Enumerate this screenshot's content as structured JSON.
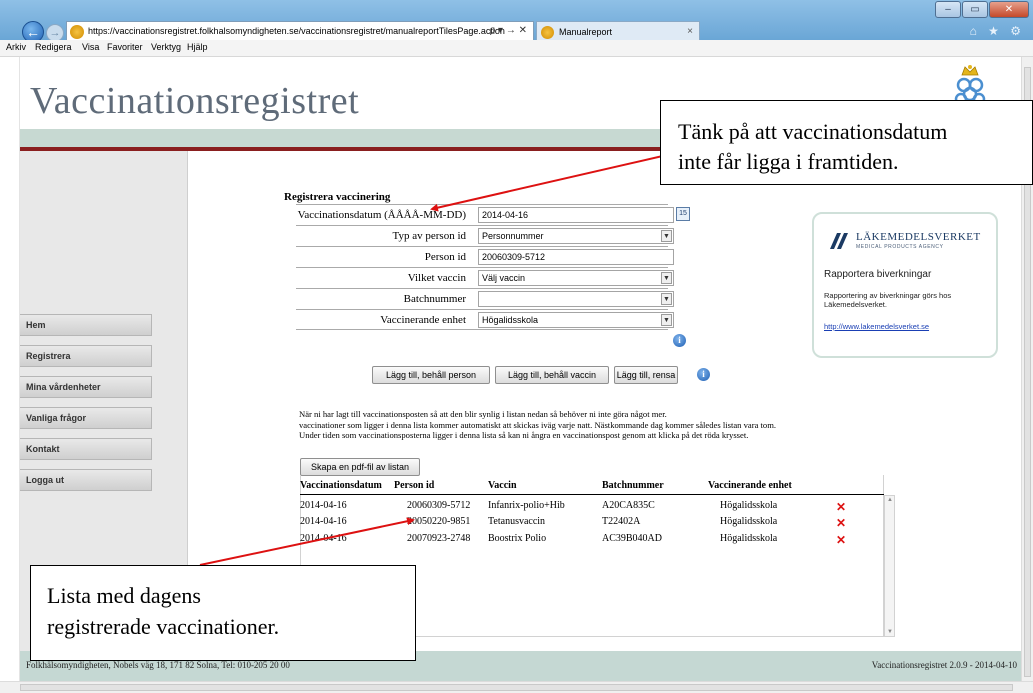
{
  "browser": {
    "url_scheme": "https://",
    "url_host": "vaccinationsregistret.folkhalsomyndigheten.se",
    "url_path": "/vaccinationsregistret/manualreportTilesPage.action",
    "url_tools": "ρ ▾ → ✕",
    "tab_title": "Manualreport",
    "tab_close": "×",
    "back_glyph": "←",
    "forward_glyph": "→",
    "window_buttons": [
      "–",
      "▭",
      "✕"
    ],
    "toolbar_icons": "⌂ ★ ⚙",
    "menu": [
      "Arkiv",
      "Redigera",
      "Visa",
      "Favoriter",
      "Verktyg",
      "Hjälp"
    ]
  },
  "site": {
    "title": "Vaccinationsregistret",
    "nav": [
      "Hem",
      "Registrera",
      "Mina vårdenheter",
      "Vanliga frågor",
      "Kontakt",
      "Logga ut"
    ],
    "footer_left": "Folkhälsomyndigheten, Nobels väg 18, 171 82 Solna, Tel: 010-205 20 00",
    "footer_right": "Vaccinationsregistret 2.0.9 - 2014-04-10"
  },
  "form": {
    "title": "Registrera vaccinering",
    "rows": [
      {
        "label": "Vaccinationsdatum (ÅÅÅÅ-MM-DD)",
        "value": "2014-04-16",
        "kind": "date"
      },
      {
        "label": "Typ av person id",
        "value": "Personnummer",
        "kind": "select"
      },
      {
        "label": "Person id",
        "value": "20060309-5712",
        "kind": "text"
      },
      {
        "label": "Vilket vaccin",
        "value": "Välj vaccin",
        "kind": "select"
      },
      {
        "label": "Batchnummer",
        "value": "",
        "kind": "select"
      },
      {
        "label": "Vaccinerande enhet",
        "value": "Högalidsskola",
        "kind": "select"
      }
    ],
    "calendar_label": "15",
    "select_arrow": "▼",
    "info_glyph": "i",
    "buttons": {
      "add_keep_person": "Lägg till, behåll person",
      "add_keep_vaccine": "Lägg till, behåll vaccin",
      "add_clear": "Lägg till, rensa"
    }
  },
  "note": [
    "När ni har lagt till vaccinationsposten så att den blir synlig i listan nedan så behöver ni inte göra något mer.",
    "vaccinationer som ligger i denna lista kommer automatiskt att skickas iväg varje natt. Nästkommande dag kommer således listan vara tom.",
    "Under tiden som vaccinationsposterna ligger i denna lista så kan ni ångra en vaccinationspost genom att klicka på det röda krysset."
  ],
  "pdf_button": "Skapa en pdf-fil av listan",
  "table": {
    "columns": [
      "Vaccinationsdatum",
      "Person id",
      "Vaccin",
      "Batchnummer",
      "Vaccinerande enhet"
    ],
    "rows": [
      [
        "2014-04-16",
        "20060309-5712",
        "Infanrix-polio+Hib",
        "A20CA835C",
        "Högalidsskola"
      ],
      [
        "2014-04-16",
        "20050220-9851",
        "Tetanusvaccin",
        "T22402A",
        "Högalidsskola"
      ],
      [
        "2014-04-16",
        "20070923-2748",
        "Boostrix Polio",
        "AC39B040AD",
        "Högalidsskola"
      ]
    ],
    "delete_glyph": "✕",
    "scroll_up": "▲",
    "scroll_down": "▼"
  },
  "lakemedelsverket": {
    "name": "LÄKEMEDELSVERKET",
    "subtitle": "MEDICAL PRODUCTS AGENCY",
    "heading": "Rapportera biverkningar",
    "text": "Rapportering av biverkningar görs hos Läkemedelsverket.",
    "link": "http://www.lakemedelsverket.se",
    "brand_color": "#1b3a63"
  },
  "callouts": {
    "top": [
      "Tänk på att vaccinationsdatum",
      "inte får ligga i framtiden."
    ],
    "bottom": [
      "Lista med dagens",
      "registrerade vaccinationer."
    ]
  },
  "colors": {
    "accent_red": "#8a1f1f",
    "teal_band": "#c7d9d2",
    "delete_red": "#dd1111"
  }
}
